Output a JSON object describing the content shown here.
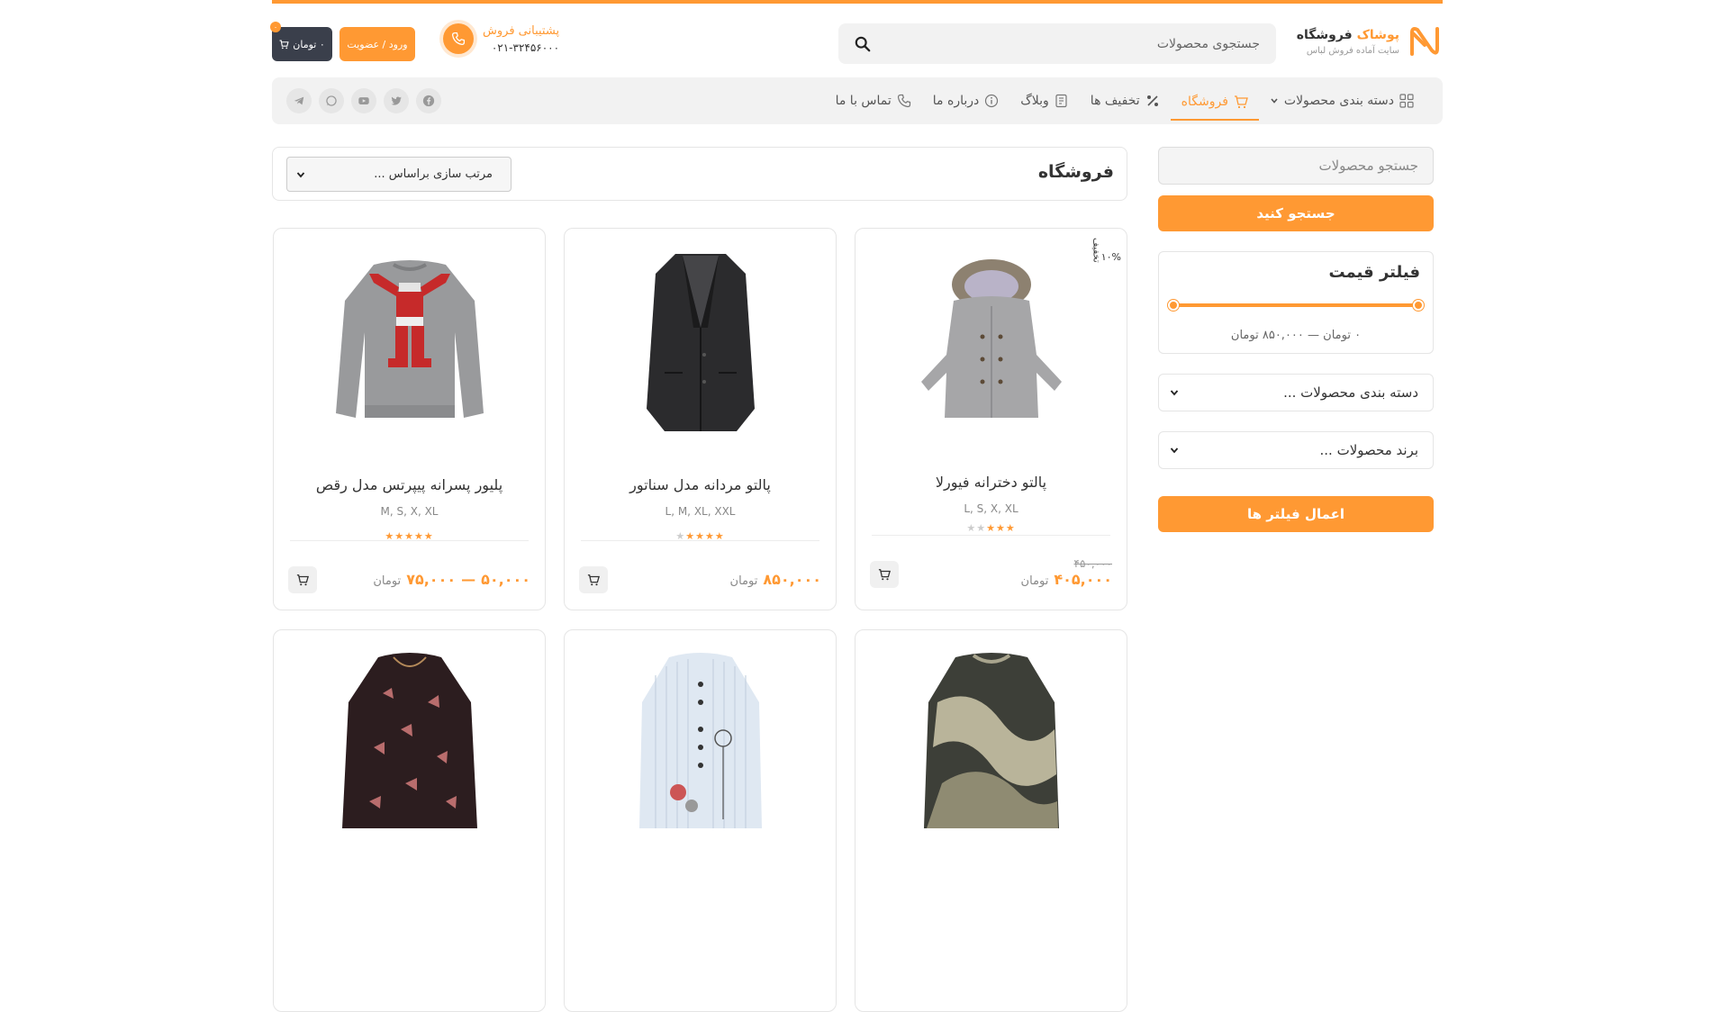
{
  "brand": {
    "name": "فروشگاه",
    "name_accent": "پوشاک",
    "tagline": "سایت آماده فروش لباس"
  },
  "header": {
    "search_placeholder": "جستجوی محصولات",
    "support_title": "پشتیبانی فروش",
    "support_phone": "۰۲۱-۳۲۴۵۶۰۰۰",
    "login_label": "ورود / عضویت",
    "cart_label": "۰ تومان",
    "cart_count": "۰"
  },
  "nav": {
    "items": [
      {
        "label": "دسته بندی محصولات",
        "icon": "grid-icon"
      },
      {
        "label": "فروشگاه",
        "icon": "cart-icon",
        "active": true
      },
      {
        "label": "تخفیف ها",
        "icon": "percent-icon"
      },
      {
        "label": "وبلاگ",
        "icon": "blog-icon"
      },
      {
        "label": "درباره ما",
        "icon": "info-icon"
      },
      {
        "label": "تماس با ما",
        "icon": "phone-icon"
      }
    ],
    "socials": [
      "telegram-icon",
      "whatsapp-icon",
      "youtube-icon",
      "twitter-icon",
      "facebook-icon"
    ]
  },
  "sidebar": {
    "search_placeholder": "جستجو محصولات",
    "search_button": "جستجو کنید",
    "price_title": "فیلتر قیمت",
    "price_range": "۰ تومان — ۸۵۰,۰۰۰ تومان",
    "category_select": "دسته بندی محصولات ...",
    "brand_select": "برند محصولات ...",
    "apply_button": "اعمال فیلتر ها"
  },
  "main": {
    "title": "فروشگاه",
    "sort_label": "مرتب سازی براساس ..."
  },
  "products": [
    {
      "name": "پالتو دخترانه فیورلا",
      "sizes": "L, S, X, XL",
      "rating": 3,
      "price": "۴۰۵,۰۰۰",
      "old_price": "۴۵۰,۰۰۰",
      "unit": "تومان",
      "discount_pct": "۱۰%",
      "discount_label": "تخفیف",
      "image": "girls-coat"
    },
    {
      "name": "پالتو مردانه مدل سناتور",
      "sizes": "L, M, XL, XXL",
      "rating": 4,
      "price": "۸۵۰,۰۰۰",
      "unit": "تومان",
      "image": "mens-coat"
    },
    {
      "name": "پلیور پسرانه پیپرتس مدل رقص",
      "sizes": "M, S, X, XL",
      "rating": 5,
      "price_min": "۵۰,۰۰۰",
      "price_max": "۷۵,۰۰۰",
      "price_sep": "—",
      "unit": "تومان",
      "image": "santa-sweater"
    },
    {
      "image": "patterned-tunic"
    },
    {
      "image": "striped-tunic"
    },
    {
      "image": "butterfly-top"
    }
  ],
  "colors": {
    "accent": "#ff9933",
    "dark": "#3a3f4b"
  }
}
